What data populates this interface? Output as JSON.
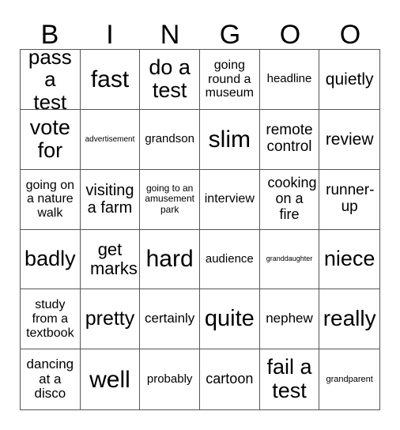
{
  "header": [
    "B",
    "I",
    "N",
    "G",
    "O",
    "O"
  ],
  "cells": [
    "pass a test",
    "fast",
    "do a test",
    "going round a museum",
    "headline",
    "quietly",
    "vote for",
    "advertisement",
    "grandson",
    "slim",
    "remote control",
    "review",
    "going on a nature walk",
    "visiting a farm",
    "going to an amusement park",
    "interview",
    "cooking on a fire",
    "runner-up",
    "badly",
    "get marks",
    "hard",
    "audience",
    "granddaughter",
    "niece",
    "study from a textbook",
    "pretty",
    "certainly",
    "quite",
    "nephew",
    "really",
    "dancing at a disco",
    "well",
    "probably",
    "cartoon",
    "fail a test",
    "grandparent"
  ]
}
